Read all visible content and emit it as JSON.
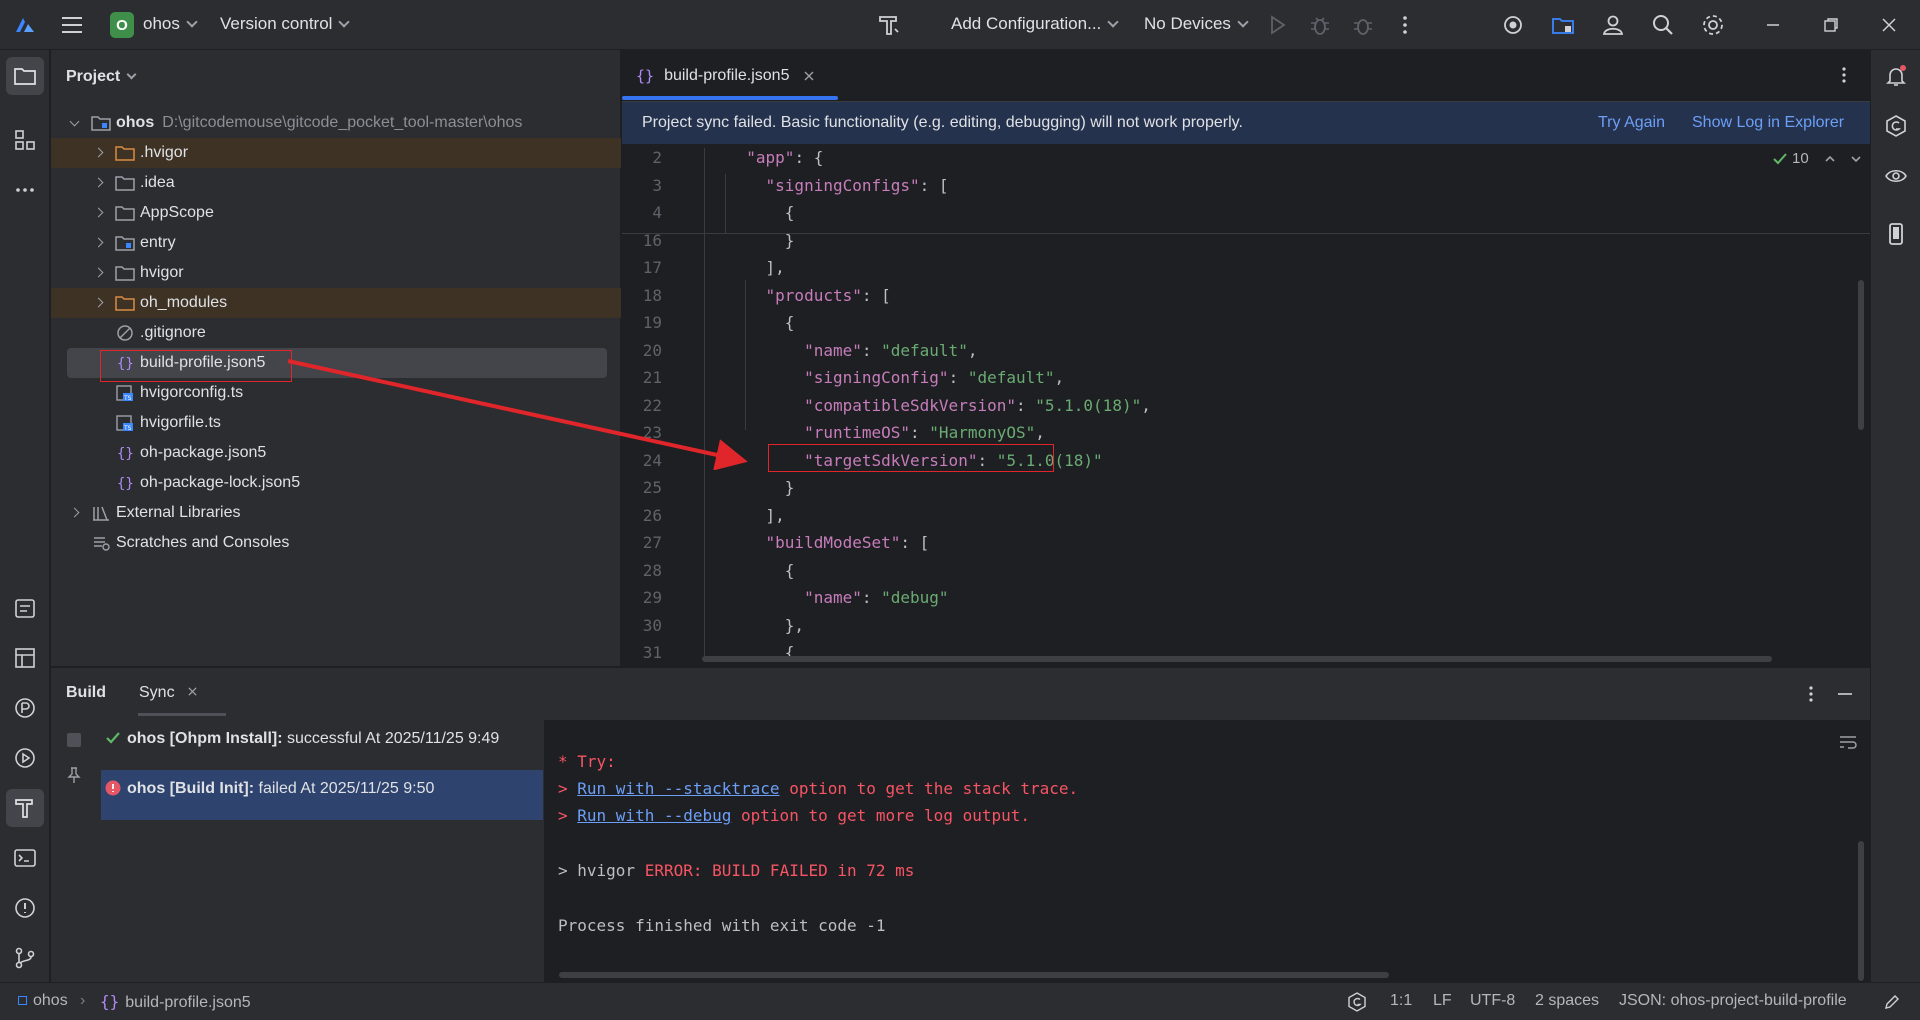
{
  "titlebar": {
    "project_badge": "O",
    "project_name": "ohos",
    "version_control": "Version control",
    "run_config": "Add Configuration...",
    "devices": "No Devices"
  },
  "project_panel": {
    "title": "Project",
    "root": {
      "name": "ohos",
      "path": "D:\\gitcodemouse\\gitcode_pocket_tool-master\\ohos"
    },
    "items": [
      {
        "label": ".hvigor",
        "type": "folder",
        "excluded": true
      },
      {
        "label": ".idea",
        "type": "folder"
      },
      {
        "label": "AppScope",
        "type": "folder"
      },
      {
        "label": "entry",
        "type": "folder"
      },
      {
        "label": "hvigor",
        "type": "folder"
      },
      {
        "label": "oh_modules",
        "type": "folder",
        "excluded": true
      },
      {
        "label": ".gitignore",
        "type": "ignore"
      },
      {
        "label": "build-profile.json5",
        "type": "json",
        "selected": true
      },
      {
        "label": "hvigorconfig.ts",
        "type": "ts"
      },
      {
        "label": "hvigorfile.ts",
        "type": "ts"
      },
      {
        "label": "oh-package.json5",
        "type": "json"
      },
      {
        "label": "oh-package-lock.json5",
        "type": "json"
      }
    ],
    "external": "External Libraries",
    "scratches": "Scratches and Consoles"
  },
  "editor": {
    "tab_label": "build-profile.json5",
    "banner_message": "Project sync failed. Basic functionality (e.g. editing, debugging) will not work properly.",
    "banner_try_again": "Try Again",
    "banner_show_log": "Show Log in Explorer",
    "inspection_count": "10",
    "lines": [
      {
        "n": "2",
        "text": "  \"app\": {"
      },
      {
        "n": "3",
        "text": "    \"signingConfigs\": ["
      },
      {
        "n": "4",
        "text": "      {"
      },
      {
        "n": "16",
        "text": "      }"
      },
      {
        "n": "17",
        "text": "    ],"
      },
      {
        "n": "18",
        "text": "    \"products\": ["
      },
      {
        "n": "19",
        "text": "      {"
      },
      {
        "n": "20",
        "text": "        \"name\": \"default\","
      },
      {
        "n": "21",
        "text": "        \"signingConfig\": \"default\","
      },
      {
        "n": "22",
        "text": "        \"compatibleSdkVersion\": \"5.1.0(18)\","
      },
      {
        "n": "23",
        "text": "        \"runtimeOS\": \"HarmonyOS\","
      },
      {
        "n": "24",
        "text": "        \"targetSdkVersion\": \"5.1.0(18)\""
      },
      {
        "n": "25",
        "text": "      }"
      },
      {
        "n": "26",
        "text": "    ],"
      },
      {
        "n": "27",
        "text": "    \"buildModeSet\": ["
      },
      {
        "n": "28",
        "text": "      {"
      },
      {
        "n": "29",
        "text": "        \"name\": \"debug\""
      },
      {
        "n": "30",
        "text": "      },"
      },
      {
        "n": "31",
        "text": "      {"
      }
    ]
  },
  "build_panel": {
    "tab_build": "Build",
    "tab_sync": "Sync",
    "tasks": [
      {
        "name": "ohos [Ohpm Install]:",
        "status": "successful At 2025/11/25 9:49",
        "ok": true
      },
      {
        "name": "ohos [Build Init]:",
        "status": "failed At 2025/11/25 9:50",
        "ok": false
      }
    ],
    "console": {
      "try": "* Try:",
      "line1_prefix": "> ",
      "line1_link": "Run with --stacktrace",
      "line1_rest": " option to get the stack trace.",
      "line2_prefix": "> ",
      "line2_link": "Run with --debug",
      "line2_rest": " option to get more log output.",
      "hvigor_prefix": "> hvigor ",
      "hvigor_error": "ERROR: BUILD FAILED in 72 ms",
      "exit": "Process finished with exit code -1"
    }
  },
  "statusbar": {
    "breadcrumb_project": "ohos",
    "breadcrumb_file": "build-profile.json5",
    "position": "1:1",
    "line_sep": "LF",
    "encoding": "UTF-8",
    "indent": "2 spaces",
    "schema": "JSON: ohos-project-build-profile"
  }
}
